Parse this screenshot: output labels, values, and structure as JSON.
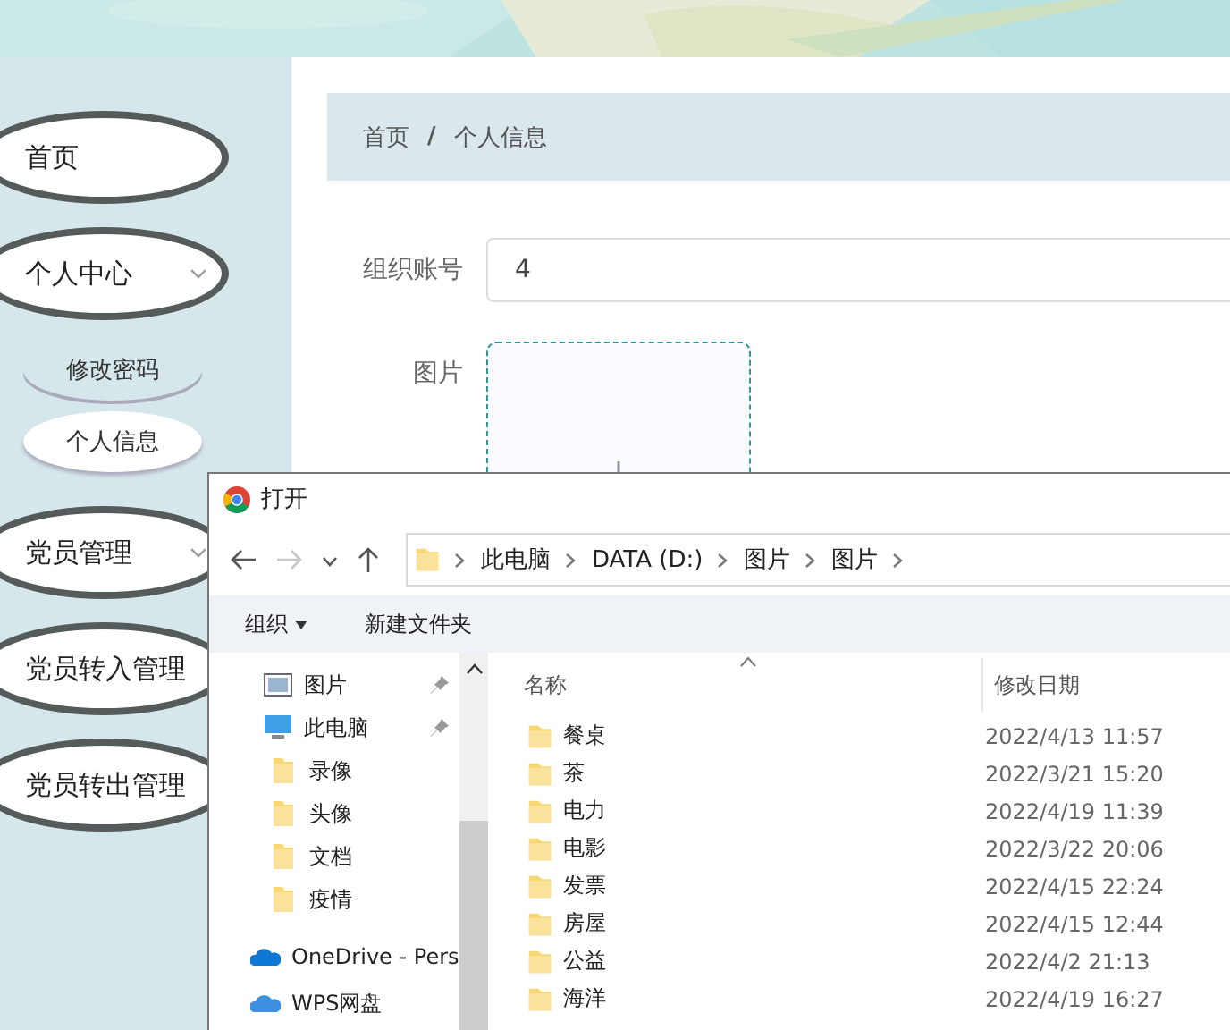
{
  "banner": {
    "kind": "picture"
  },
  "sidebar": {
    "items": [
      {
        "label": "首页",
        "kind": "link"
      },
      {
        "label": "个人中心",
        "kind": "submenu",
        "children": [
          {
            "label": "修改密码",
            "selected": false
          },
          {
            "label": "个人信息",
            "selected": true
          }
        ]
      },
      {
        "label": "党员管理",
        "kind": "submenu"
      },
      {
        "label": "党员转入管理",
        "kind": "link"
      },
      {
        "label": "党员转出管理",
        "kind": "link"
      }
    ]
  },
  "breadcrumb": [
    "首页",
    "/",
    "个人信息"
  ],
  "form": {
    "fields": [
      {
        "label": "组织账号",
        "kind": "text",
        "value": "4"
      },
      {
        "label": "图片",
        "kind": "upload"
      }
    ]
  },
  "dialog": {
    "title": "打开",
    "nav_buttons": [
      {
        "kind": "back",
        "disabled": false
      },
      {
        "kind": "forward",
        "disabled": true
      },
      {
        "kind": "recent",
        "disabled": false
      },
      {
        "kind": "up",
        "disabled": false
      }
    ],
    "path": [
      "此电脑",
      "DATA (D:)",
      "图片",
      "图片"
    ],
    "toolbar": [
      {
        "label": "组织",
        "kind": "menu"
      },
      {
        "label": "新建文件夹",
        "kind": "button"
      }
    ],
    "nav": [
      {
        "label": "图片",
        "kind": "pictures",
        "pinned": true
      },
      {
        "label": "此电脑",
        "kind": "computer",
        "pinned": true
      },
      {
        "label": "录像",
        "kind": "folder",
        "pinned": false
      },
      {
        "label": "头像",
        "kind": "folder",
        "pinned": false
      },
      {
        "label": "文档",
        "kind": "folder",
        "pinned": false
      },
      {
        "label": "疫情",
        "kind": "folder",
        "pinned": false
      },
      {
        "label": "OneDrive - Pers",
        "kind": "onedrive",
        "pinned": false
      },
      {
        "label": "WPS网盘",
        "kind": "cloud",
        "pinned": false
      }
    ],
    "columns": [
      "名称",
      "修改日期"
    ],
    "files": [
      {
        "name": "餐桌",
        "modified": "2022/4/13 11:57"
      },
      {
        "name": "茶",
        "modified": "2022/3/21 15:20"
      },
      {
        "name": "电力",
        "modified": "2022/4/19 11:39"
      },
      {
        "name": "电影",
        "modified": "2022/3/22 20:06"
      },
      {
        "name": "发票",
        "modified": "2022/4/15 22:24"
      },
      {
        "name": "房屋",
        "modified": "2022/4/15 12:44"
      },
      {
        "name": "公益",
        "modified": "2022/4/2 21:13"
      },
      {
        "name": "海洋",
        "modified": "2022/4/19 16:27"
      }
    ]
  }
}
